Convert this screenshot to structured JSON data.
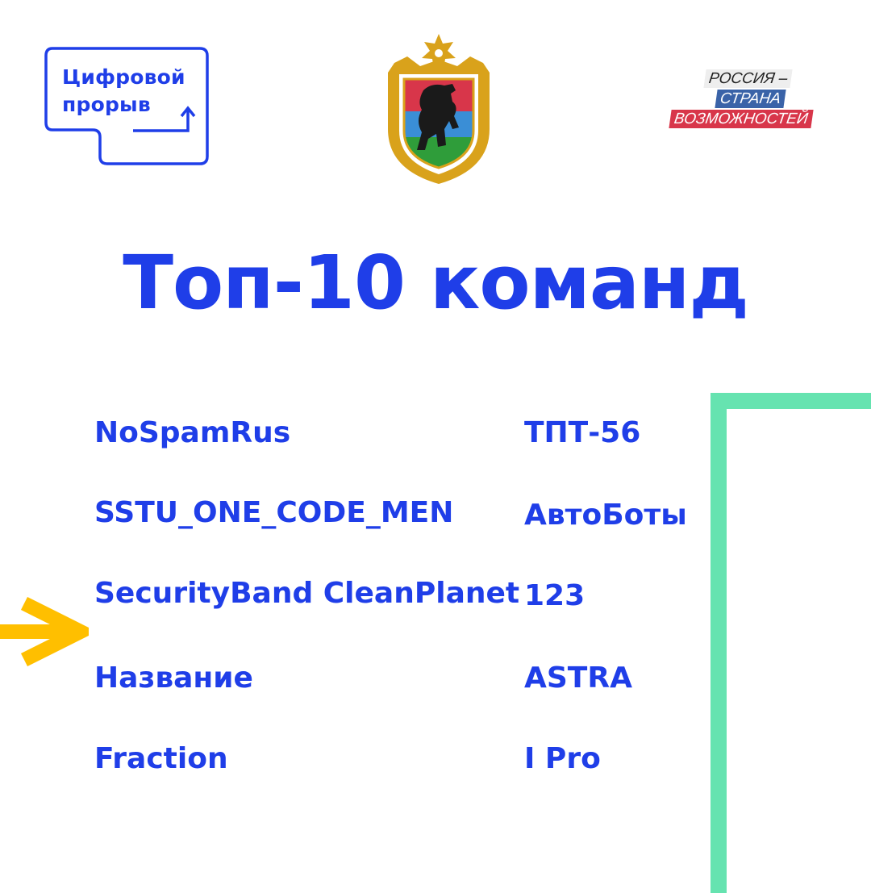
{
  "logo_left": {
    "line1": "Цифровой",
    "line2": "прорыв"
  },
  "logo_right": {
    "line1": "РОССИЯ –",
    "line2": "СТРАНА",
    "line3": "ВОЗМОЖНОСТЕЙ"
  },
  "title": "Топ-10 команд",
  "teams": {
    "left": [
      "NoSpamRus",
      "SSTU_ONE_CODE_MEN",
      "SecurityBand CleanPlanet",
      "Название",
      "Fraction"
    ],
    "right": [
      "ТПТ-56",
      "АвтоБоты",
      "123",
      "ASTRA",
      "I Pro"
    ]
  },
  "colors": {
    "brand_blue": "#1f3ee8",
    "accent_green": "#66e3b0",
    "arrow_yellow": "#ffbf00"
  },
  "icons": [
    "digital-breakthrough-logo",
    "karelia-coat-of-arms",
    "russia-land-of-opportunity-logo",
    "arrow-right-icon"
  ]
}
